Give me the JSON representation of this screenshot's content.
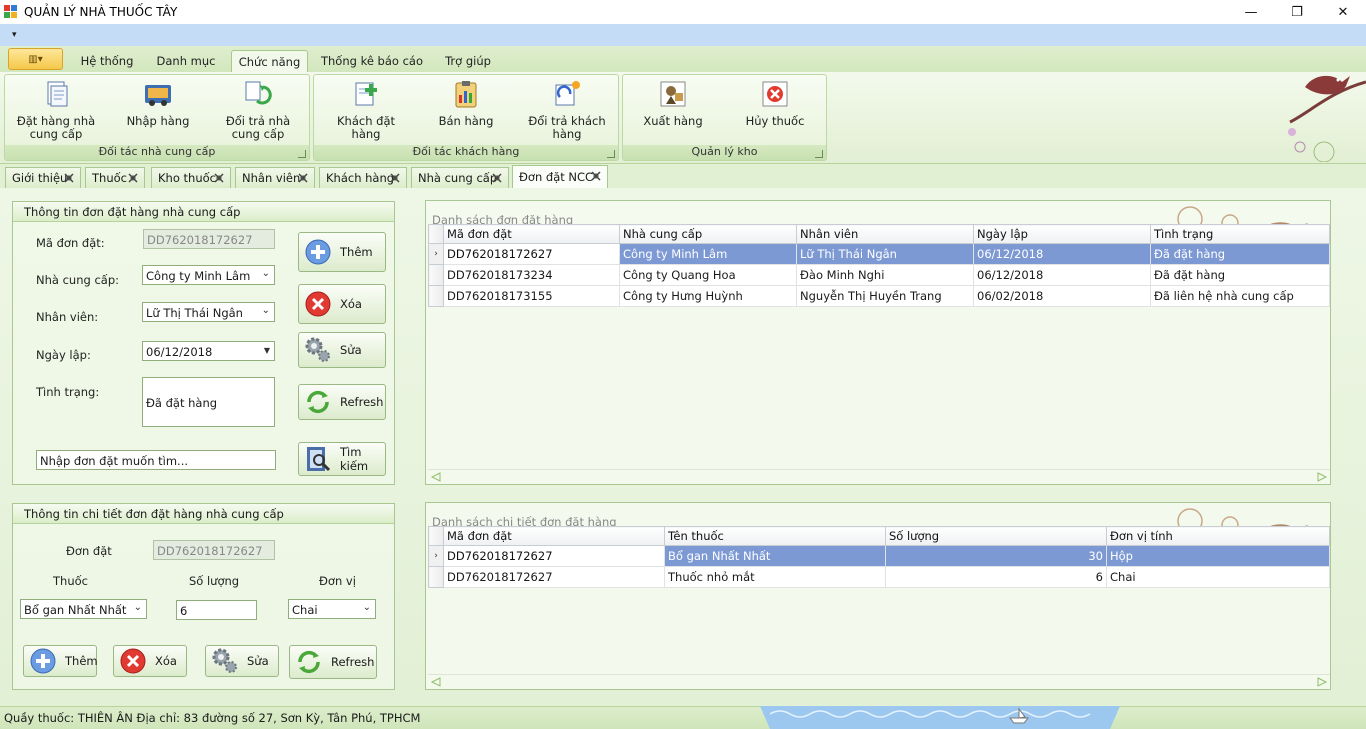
{
  "window": {
    "title": "QUẢN LÝ NHÀ THUỐC TÂY",
    "minimize_glyph": "—",
    "restore_glyph": "❐",
    "close_glyph": "✕"
  },
  "quick_access": {
    "dropdown_glyph": "▾"
  },
  "ribbon": {
    "app_menu_glyph": "▥▾",
    "tabs": [
      {
        "label": "Hệ thống",
        "active": false
      },
      {
        "label": "Danh mục",
        "active": false
      },
      {
        "label": "Chức năng",
        "active": true
      },
      {
        "label": "Thống kê báo cáo",
        "active": false
      },
      {
        "label": "Trợ giúp",
        "active": false
      }
    ],
    "groups": [
      {
        "label": "Đối tác nhà cung cấp",
        "buttons": [
          {
            "label": "Đặt hàng nhà cung cấp",
            "icon": "order-document-icon"
          },
          {
            "label": "Nhập hàng",
            "icon": "import-truck-icon"
          },
          {
            "label": "Đổi trả nhà cung cấp",
            "icon": "exchange-supplier-icon"
          }
        ]
      },
      {
        "label": "Đối tác khách hàng",
        "buttons": [
          {
            "label": "Khách đặt hàng",
            "icon": "customer-order-add-icon"
          },
          {
            "label": "Bán hàng",
            "icon": "sales-clipboard-icon"
          },
          {
            "label": "Đổi trả khách hàng",
            "icon": "exchange-customer-icon"
          }
        ]
      },
      {
        "label": "Quản lý kho",
        "buttons": [
          {
            "label": "Xuất hàng",
            "icon": "export-goods-icon"
          },
          {
            "label": "Hủy thuốc",
            "icon": "cancel-medicine-icon"
          }
        ]
      }
    ]
  },
  "doc_tabs": [
    {
      "label": "Giới thiệu",
      "active": false
    },
    {
      "label": "Thuốc",
      "active": false
    },
    {
      "label": "Kho thuốc",
      "active": false
    },
    {
      "label": "Nhân viên",
      "active": false
    },
    {
      "label": "Khách hàng",
      "active": false
    },
    {
      "label": "Nhà cung cấp",
      "active": false
    },
    {
      "label": "Đơn đặt NCC",
      "active": true
    }
  ],
  "order_info": {
    "title": "Thông tin đơn đặt hàng nhà cung cấp",
    "order_id_label": "Mã đơn đặt:",
    "order_id_value": "DD762018172627",
    "supplier_label": "Nhà cung cấp:",
    "supplier_value": "Công ty Minh Lâm",
    "employee_label": "Nhân viên:",
    "employee_value": "Lữ Thị Thái Ngân",
    "date_label": "Ngày lập:",
    "date_value": "06/12/2018",
    "status_label": "Tình trạng:",
    "status_value": "Đã đặt hàng",
    "search_value": "Nhập đơn đặt muốn tìm...",
    "buttons": {
      "add": "Thêm",
      "delete": "Xóa",
      "edit": "Sửa",
      "refresh": "Refresh",
      "search": "Tìm kiếm"
    }
  },
  "detail_info": {
    "title": "Thông tin chi tiết đơn đặt hàng nhà cung cấp",
    "order_label": "Đơn đặt",
    "order_value": "DD762018172627",
    "medicine_label": "Thuốc",
    "quantity_label": "Số lượng",
    "unit_label": "Đơn vị",
    "medicine_value": "Bổ gan Nhất Nhất",
    "quantity_value": "6",
    "unit_value": "Chai",
    "buttons": {
      "add": "Thêm",
      "delete": "Xóa",
      "edit": "Sửa",
      "refresh": "Refresh"
    }
  },
  "orders_grid": {
    "title": "Danh sách đơn đặt hàng",
    "columns": [
      "Mã đơn đặt",
      "Nhà cung cấp",
      "Nhân viên",
      "Ngày lập",
      "Tình trạng"
    ],
    "rows": [
      [
        "DD762018172627",
        "Công ty Minh Lâm",
        "Lữ Thị Thái Ngân",
        "06/12/2018",
        "Đã đặt hàng"
      ],
      [
        "DD762018173234",
        "Công ty Quang Hoa",
        "Đào Minh Nghi",
        "06/12/2018",
        "Đã đặt hàng"
      ],
      [
        "DD762018173155",
        "Công ty Hưng Huỳnh",
        "Nguyễn Thị Huyền Trang",
        "06/02/2018",
        "Đã liên hệ nhà cung cấp"
      ]
    ],
    "selected_row": 0
  },
  "details_grid": {
    "title": "Danh sách chi tiết đơn đặt hàng",
    "columns": [
      "Mã đơn đặt",
      "Tên thuốc",
      "Số lượng",
      "Đơn vị tính"
    ],
    "rows": [
      [
        "DD762018172627",
        "Bổ gan Nhất Nhất",
        "30",
        "Hộp"
      ],
      [
        "DD762018172627",
        "Thuốc nhỏ mắt",
        "6",
        "Chai"
      ]
    ],
    "selected_row": 0
  },
  "status_bar": {
    "text": "Quầy thuốc: THIÊN ÂN  Địa chỉ: 83 đường số 27, Sơn Kỳ, Tân Phú, TPHCM"
  },
  "colors": {
    "accent": "#7d99d4",
    "ribbon": "#e2efd3",
    "title_bar": "#ffffff",
    "qat": "#c4dcf6"
  }
}
